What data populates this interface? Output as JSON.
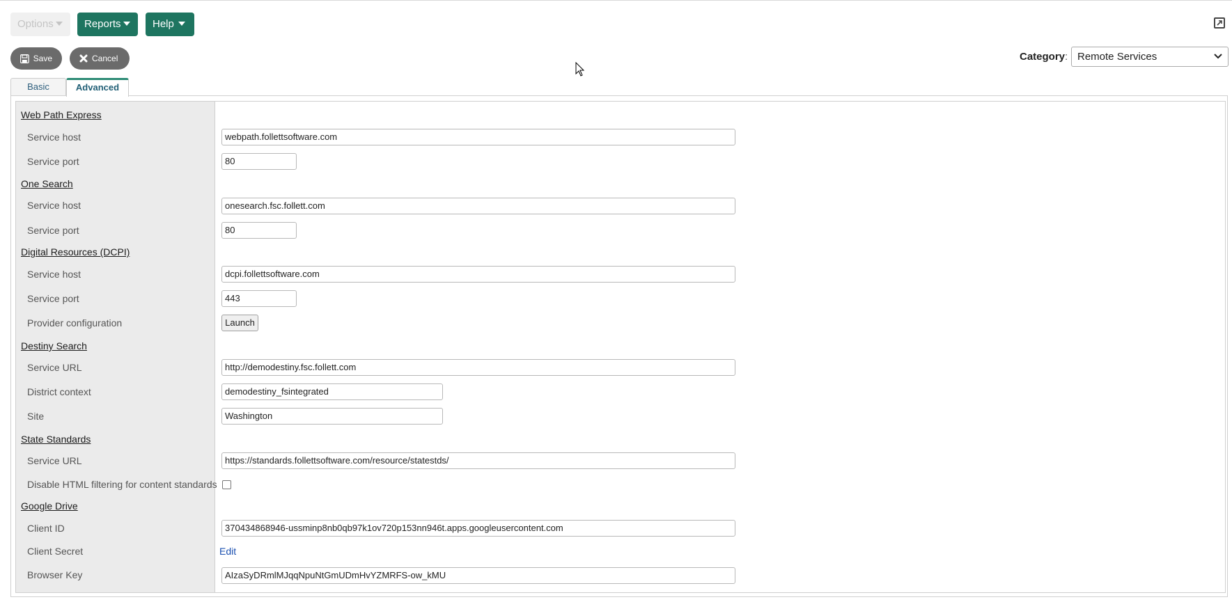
{
  "toolbar": {
    "options_label": "Options",
    "reports_label": "Reports",
    "help_label": "Help",
    "save_label": "Save",
    "cancel_label": "Cancel"
  },
  "category": {
    "label": "Category",
    "colon": ":",
    "selected": "Remote Services"
  },
  "tabs": {
    "basic": "Basic",
    "advanced": "Advanced"
  },
  "sections": {
    "web_path": {
      "title": "Web Path Express",
      "host_label": "Service host",
      "host_value": "webpath.follettsoftware.com",
      "port_label": "Service port",
      "port_value": "80"
    },
    "one_search": {
      "title": "One Search",
      "host_label": "Service host",
      "host_value": "onesearch.fsc.follett.com",
      "port_label": "Service port",
      "port_value": "80"
    },
    "dcpi": {
      "title": "Digital Resources (DCPI)",
      "host_label": "Service host",
      "host_value": "dcpi.follettsoftware.com",
      "port_label": "Service port",
      "port_value": "443",
      "provider_label": "Provider configuration",
      "launch_label": "Launch"
    },
    "destiny": {
      "title": "Destiny Search",
      "url_label": "Service URL",
      "url_value": "http://demodestiny.fsc.follett.com",
      "district_label": "District context",
      "district_value": "demodestiny_fsintegrated",
      "site_label": "Site",
      "site_value": "Washington"
    },
    "standards": {
      "title": "State Standards",
      "url_label": "Service URL",
      "url_value": "https://standards.follettsoftware.com/resource/statestds/",
      "filter_label": "Disable HTML filtering for content standards"
    },
    "google": {
      "title": "Google Drive",
      "client_id_label": "Client ID",
      "client_id_value": "370434868946-ussminp8nb0qb97k1ov720p153nn946t.apps.googleusercontent.com",
      "secret_label": "Client Secret",
      "edit_label": "Edit",
      "browser_key_label": "Browser Key",
      "browser_key_value": "AIzaSyDRmlMJqqNpuNtGmUDmHvYZMRFS-ow_kMU"
    }
  },
  "colors": {
    "primary": "#1e7560",
    "action": "#6b6b6b",
    "tab_accent": "#2b8a74",
    "link": "#1a4fb0"
  }
}
